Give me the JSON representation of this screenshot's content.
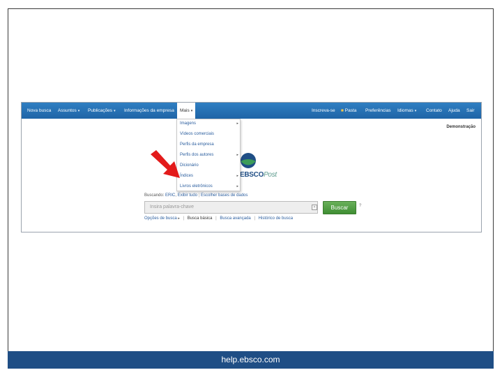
{
  "navbar": {
    "left_items": [
      "Nova busca",
      "Assuntos",
      "Publicações",
      "Informações da empresa",
      "Mais"
    ],
    "right_items": [
      "Inscreva-se",
      "Pasta",
      "Preferências",
      "Idiomas",
      "Contato",
      "Ajuda",
      "Sair"
    ]
  },
  "demo_label": "Demonstração",
  "dropdown": {
    "items": [
      "Imagens",
      "Vídeos comerciais",
      "Perfis da empresa",
      "Perfis dos autores",
      "Dicionário",
      "Índices",
      "Livros eletrônicos"
    ]
  },
  "logo": {
    "brand": "EBSCO",
    "suffix": "Post"
  },
  "search": {
    "searching_label": "Buscando:",
    "database": "ERIC",
    "show_all": "Exibir tudo",
    "choose_databases": "Escolher bases de dados",
    "placeholder": "Insira palavra-chave",
    "button_label": "Buscar",
    "help": "?"
  },
  "options": {
    "search_options": "Opções de busca",
    "basic": "Busca básica",
    "advanced": "Busca avançada",
    "history": "Histórico de busca"
  },
  "footer": {
    "text": "help.ebsco.com"
  },
  "colors": {
    "nav": "#1f64a6",
    "footer": "#1f4e85",
    "button": "#4f9e41",
    "arrow": "#e31b1b"
  }
}
